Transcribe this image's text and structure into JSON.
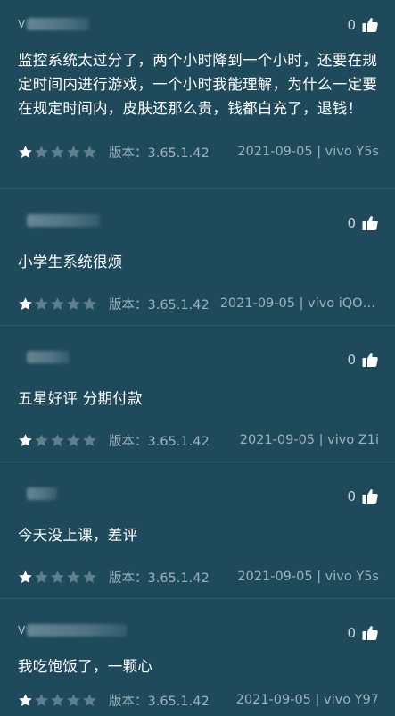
{
  "reviews": [
    {
      "user_initial": "V",
      "likes": "0",
      "content": "监控系统太过分了，两个小时降到一个小时，还要在规定时间内进行游戏，一个小时我能理解，为什么一定要在规定时间内，皮肤还那么贵，钱都白充了，退钱！",
      "rating": 1,
      "version": "版本：3.65.1.42",
      "date_device": "2021-09-05 | vivo Y5s"
    },
    {
      "user_initial": "",
      "likes": "0",
      "content": "小学生系统很烦",
      "rating": 1,
      "version": "版本：3.65.1.42",
      "date_device": "2021-09-05 | vivo iQOO…"
    },
    {
      "user_initial": "",
      "likes": "0",
      "content": "五星好评 分期付款",
      "rating": 1,
      "version": "版本：3.65.1.42",
      "date_device": "2021-09-05 | vivo Z1i"
    },
    {
      "user_initial": "",
      "likes": "0",
      "content": "今天没上课，差评",
      "rating": 1,
      "version": "版本：3.65.1.42",
      "date_device": "2021-09-05 | vivo Y5s"
    },
    {
      "user_initial": "V",
      "likes": "0",
      "content": "我吃饱饭了，一颗心",
      "rating": 1,
      "version": "版本：3.65.1.42",
      "date_device": "2021-09-05 | vivo Y97"
    }
  ],
  "colors": {
    "background": "#1f4a5c",
    "star_filled": "#ffffff",
    "star_empty": "#5f7f8c",
    "meta_text": "#9db3bc"
  }
}
